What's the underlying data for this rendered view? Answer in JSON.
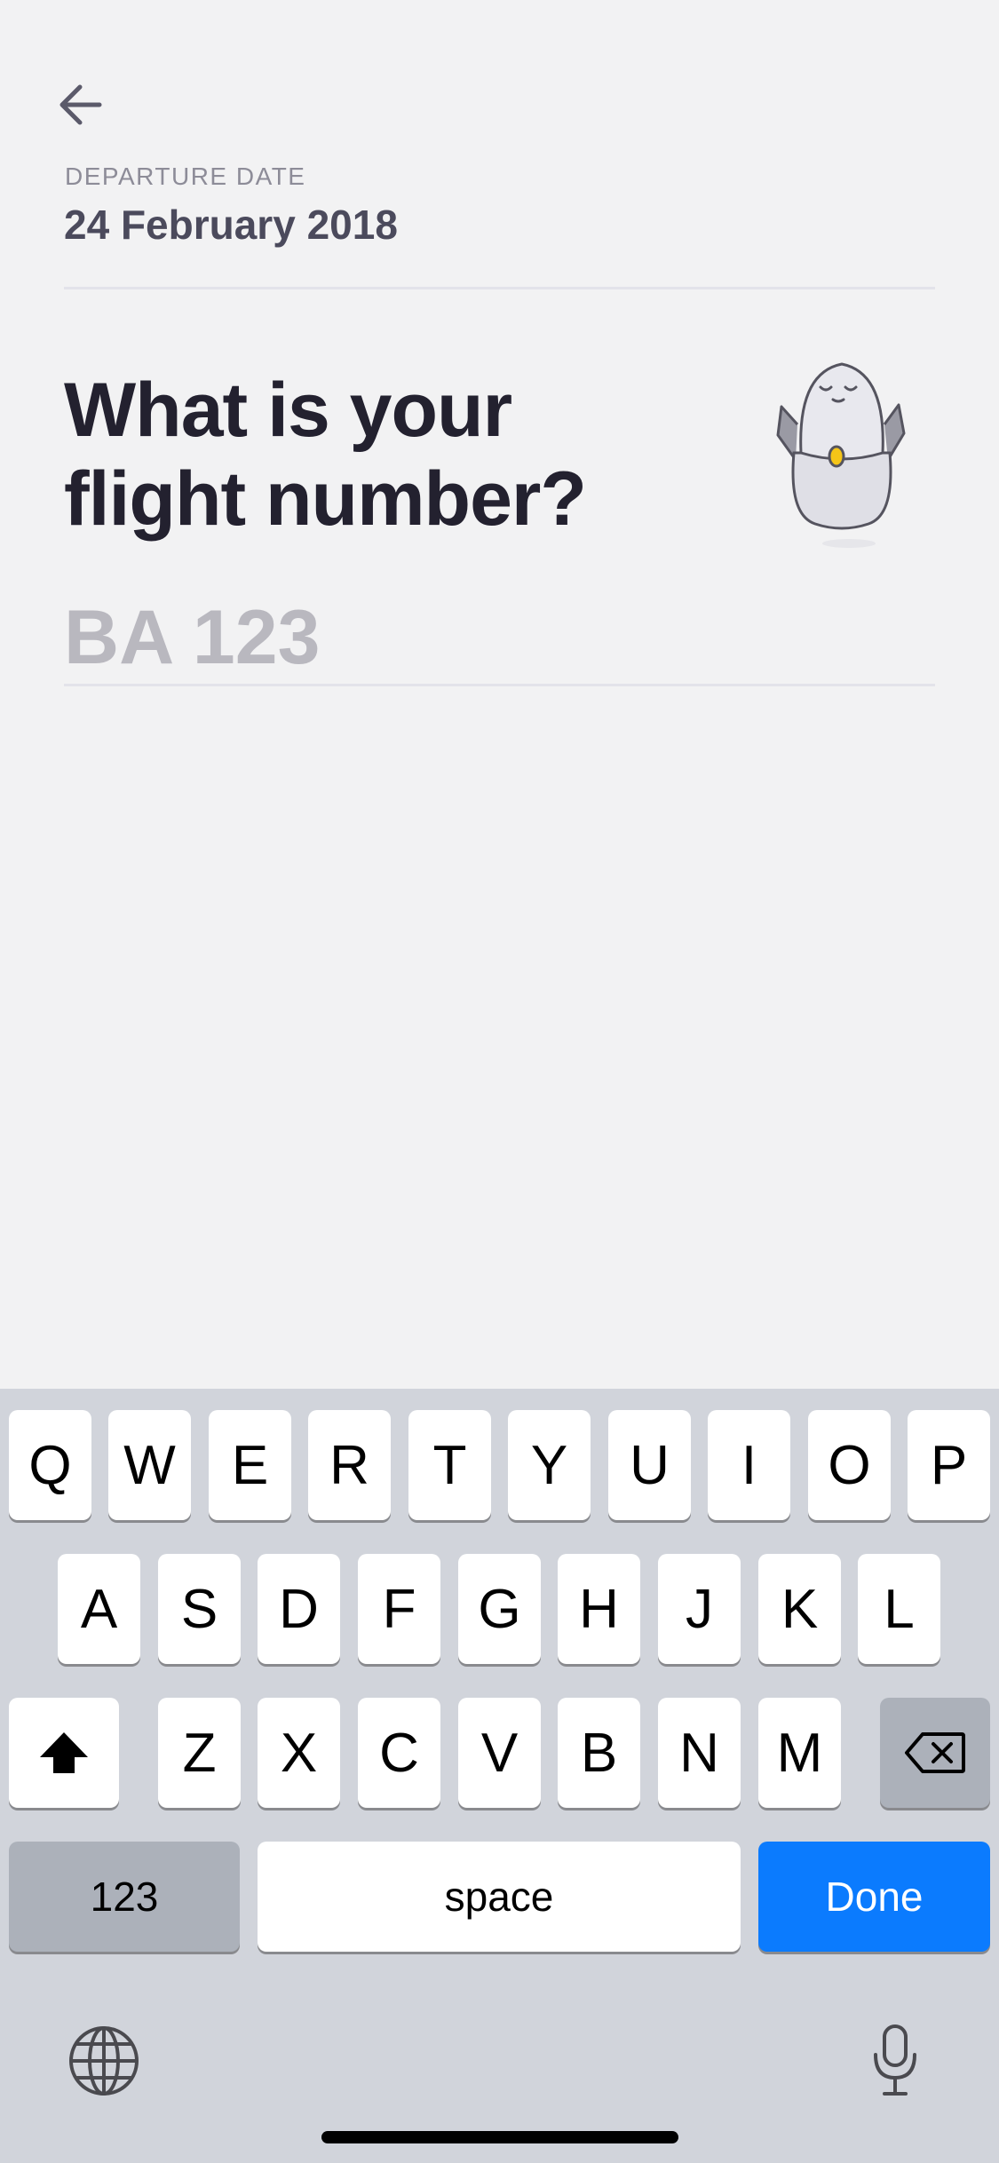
{
  "header": {
    "back_icon": "arrow-left-icon",
    "date_label": "DEPARTURE DATE",
    "date_value": "24 February 2018"
  },
  "question": {
    "line1": "What is your",
    "line2": "flight number?"
  },
  "flight_input": {
    "value": "",
    "placeholder": "BA 123"
  },
  "mascot": {
    "icon": "robot-mascot-icon"
  },
  "keyboard": {
    "row1": [
      "Q",
      "W",
      "E",
      "R",
      "T",
      "Y",
      "U",
      "I",
      "O",
      "P"
    ],
    "row2": [
      "A",
      "S",
      "D",
      "F",
      "G",
      "H",
      "J",
      "K",
      "L"
    ],
    "row3": [
      "Z",
      "X",
      "C",
      "V",
      "B",
      "N",
      "M"
    ],
    "shift_icon": "shift-arrow-icon",
    "delete_icon": "backspace-icon",
    "numbers_label": "123",
    "space_label": "space",
    "done_label": "Done",
    "globe_icon": "globe-icon",
    "mic_icon": "microphone-icon"
  },
  "colors": {
    "background": "#f2f2f3",
    "title": "#23212f",
    "placeholder": "#b9b8bf",
    "done_key": "#0b7bfe",
    "keyboard_bg": "#d1d4db"
  }
}
